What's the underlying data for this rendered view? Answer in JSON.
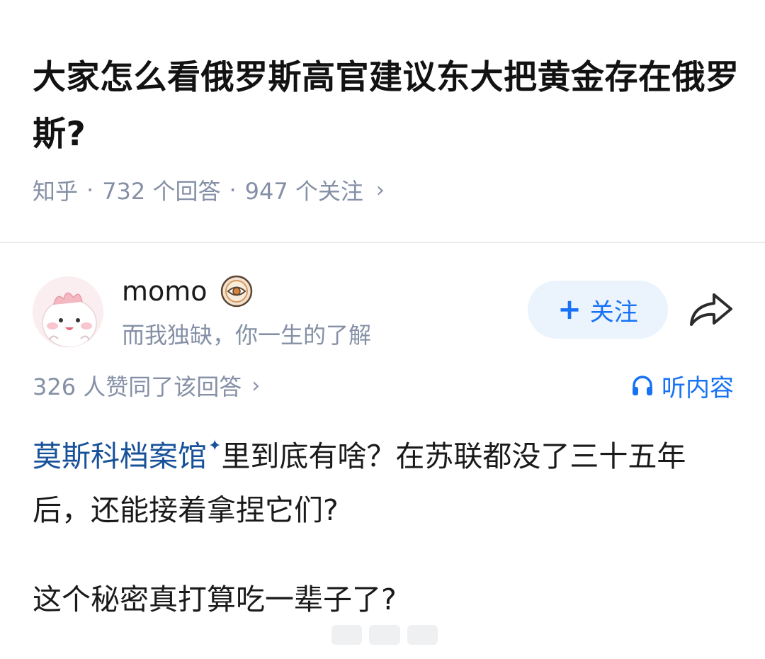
{
  "question": {
    "title": "大家怎么看俄罗斯高官建议东大把黄金存在俄罗斯?",
    "source": "知乎",
    "separator": "·",
    "answers_count": "732 个回答",
    "followers_count": "947 个关注",
    "chevron": "›"
  },
  "author": {
    "name": "momo",
    "bio": "而我独缺，你一生的了解",
    "badge_icon": "eye-badge-icon",
    "follow_plus": "+",
    "follow_label": "关注",
    "share_icon": "share-arrow-icon"
  },
  "answer": {
    "upvote_text": "326 人赞同了该回答",
    "upvote_chevron": "›",
    "listen_label": "听内容",
    "topic_link": "莫斯科档案馆",
    "topic_spark": "✦",
    "paragraph1_rest": "里到底有啥？在苏联都没了三十五年后，还能接着拿捏它们?",
    "paragraph2": "这个秘密真打算吃一辈子了?"
  },
  "colors": {
    "accent": "#1772f6",
    "link": "#175199",
    "meta": "#8590a6",
    "follow_bg": "#ebf3fd"
  }
}
